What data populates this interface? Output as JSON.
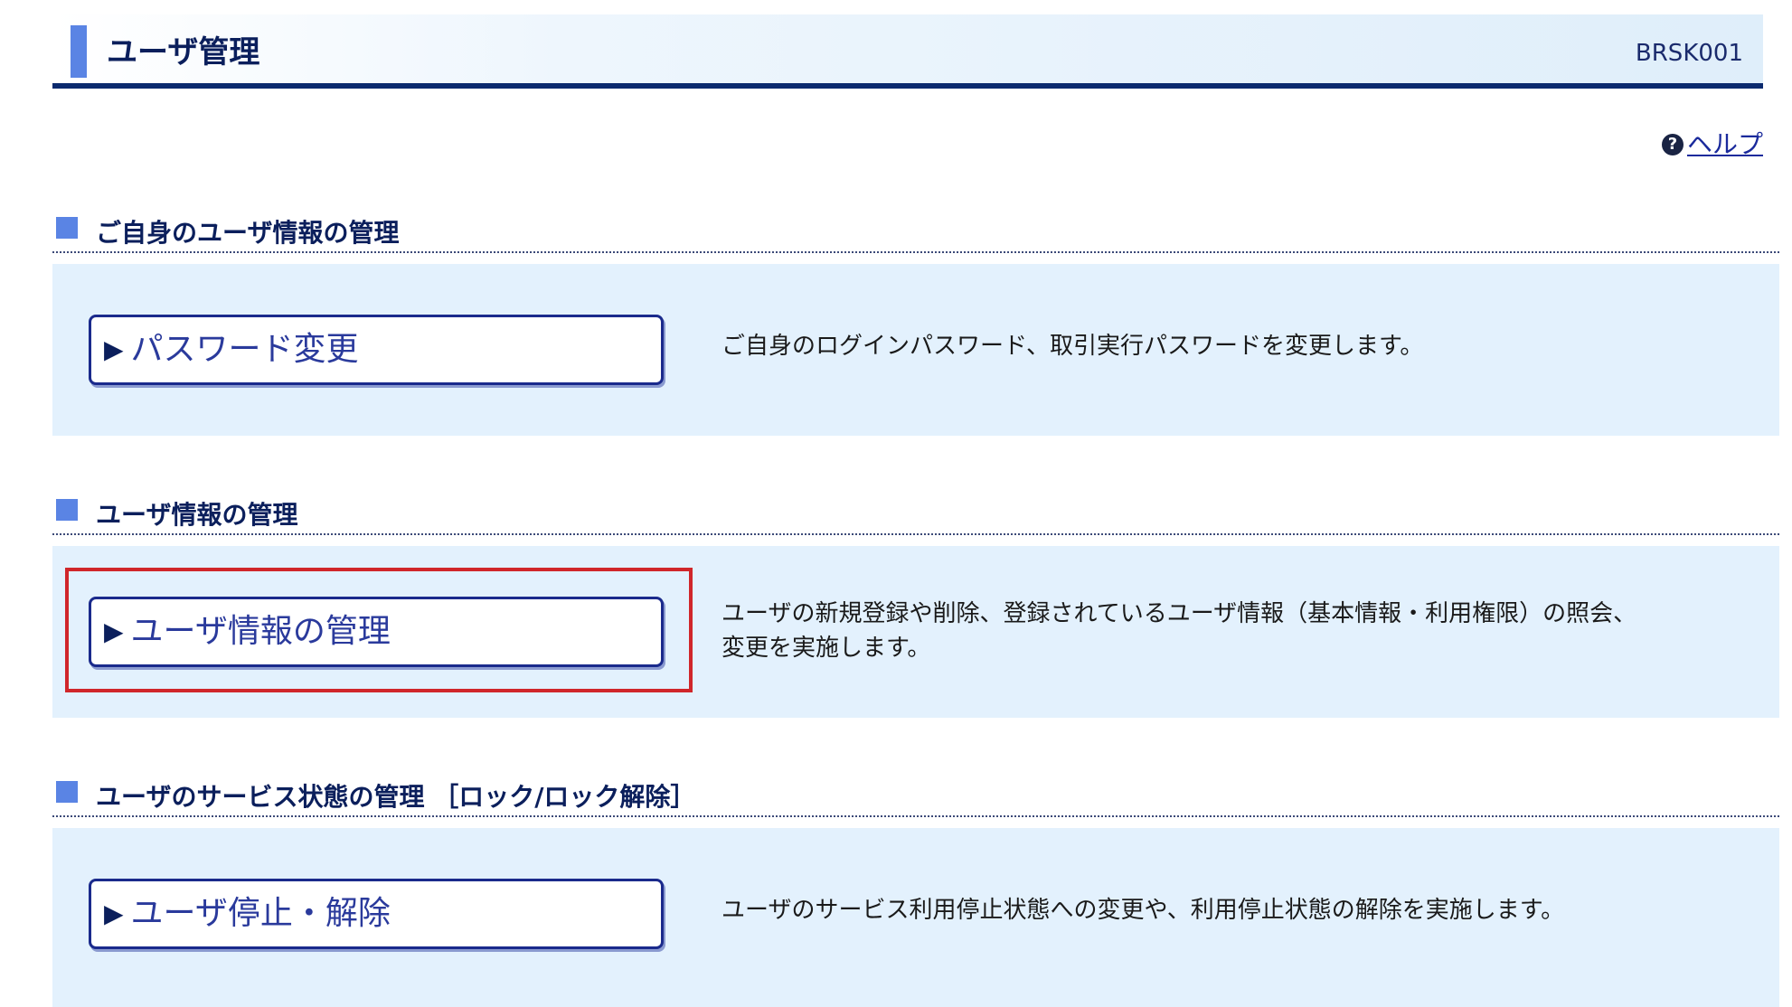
{
  "header": {
    "title": "ユーザ管理",
    "screen_id": "BRSK001"
  },
  "help": {
    "label": "ヘルプ",
    "icon": "question-circle-icon"
  },
  "sections": [
    {
      "heading": "ご自身のユーザ情報の管理",
      "button_label": "パスワード変更",
      "description_lines": [
        "ご自身のログインパスワード、取引実行パスワードを変更します。"
      ]
    },
    {
      "heading": "ユーザ情報の管理",
      "button_label": "ユーザ情報の管理",
      "description_lines": [
        "ユーザの新規登録や削除、登録されているユーザ情報（基本情報・利用権限）の照会、",
        "変更を実施します。"
      ]
    },
    {
      "heading": "ユーザのサービス状態の管理 ［ロック/ロック解除］",
      "button_label": "ユーザ停止・解除",
      "description_lines": [
        "ユーザのサービス利用停止状態への変更や、利用停止状態の解除を実施します。"
      ]
    }
  ],
  "button_arrow": "▶",
  "colors": {
    "accent": "#5a84e4",
    "navy": "#0b2a6e",
    "panel_bg": "#e3f1fd",
    "highlight": "#d0262a"
  }
}
